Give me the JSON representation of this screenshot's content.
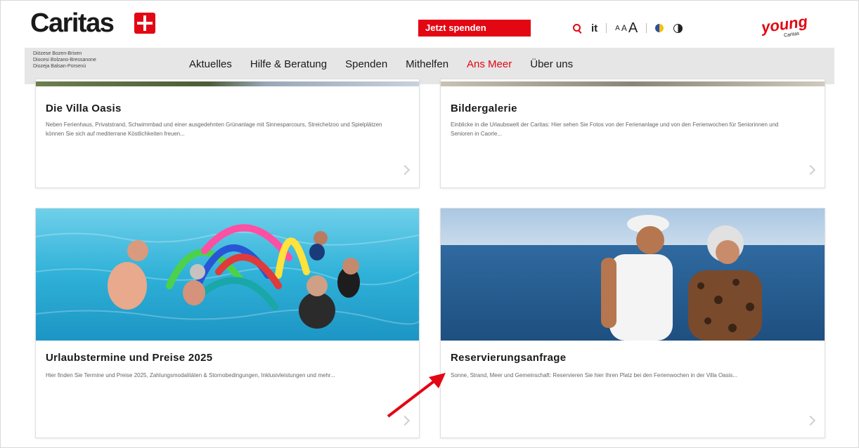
{
  "header": {
    "logo_text": "Caritas",
    "donate_label": "Jetzt spenden",
    "lang_label": "it",
    "font_sizes": [
      "A",
      "A",
      "A"
    ],
    "young_label": "young",
    "young_sub": "Caritas"
  },
  "nav": {
    "diocese_lines": [
      "Diözese Bozen-Brixen",
      "Diocesi Bolzano-Bressanone",
      "Diozeja Balsan-Porsenù"
    ],
    "items": [
      {
        "label": "Aktuelles"
      },
      {
        "label": "Hilfe & Beratung"
      },
      {
        "label": "Spenden"
      },
      {
        "label": "Mithelfen"
      },
      {
        "label": "Ans Meer"
      },
      {
        "label": "Über uns"
      }
    ],
    "active_item": "Ans Meer"
  },
  "cards": [
    {
      "title": "Die Villa Oasis",
      "text": "Neben Ferienhaus, Privatstrand, Schwimmbad und einer ausgedehnten Grünanlage mit Sinnesparcours, Streichelzoo und Spielplätzen können Sie sich auf mediterrane Köstlichkeiten freuen..."
    },
    {
      "title": "Bildergalerie",
      "text": "Einblicke in die Urlaubswelt der Caritas: Hier sehen Sie Fotos von der Ferienanlage und von den Ferienwochen für Seniorinnen und Senioren in Caorle..."
    },
    {
      "title": "Urlaubstermine und Preise 2025",
      "text": "Hier finden Sie Termine und Preise 2025, Zahlungsmodalitäten & Stornobedingungen, Inklusivleistungen und mehr..."
    },
    {
      "title": "Reservierungsanfrage",
      "text": "Sonne, Strand, Meer und Gemeinschaft: Reservieren Sie hier Ihren Platz bei den Ferienwochen in der Villa Oasis..."
    }
  ],
  "colors": {
    "brand": "#e30613",
    "nav_bg": "#e6e6e6"
  }
}
